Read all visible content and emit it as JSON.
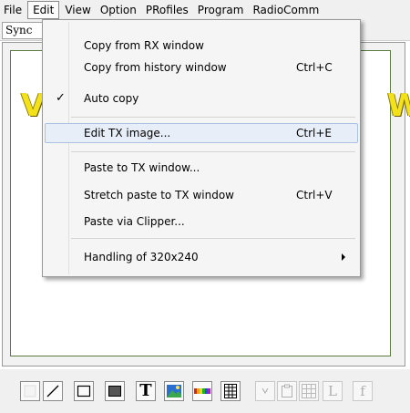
{
  "menubar": {
    "items": [
      "File",
      "Edit",
      "View",
      "Option",
      "PRofiles",
      "Program",
      "RadioComm"
    ],
    "active": "Edit"
  },
  "toolbar_row": {
    "sync_label": "Sync"
  },
  "canvas": {
    "left_text": "V",
    "right_text": "W",
    "text_color": "#f3e21a",
    "border_color": "#5a7a40"
  },
  "edit_menu": {
    "items": [
      {
        "label": "Copy from RX window",
        "shortcut": "",
        "checked": false
      },
      {
        "label": "Copy from history window",
        "shortcut": "Ctrl+C",
        "checked": false
      },
      {
        "label": "Auto copy",
        "shortcut": "",
        "checked": true,
        "check_glyph": "✓"
      },
      {
        "label": "Edit TX image...",
        "shortcut": "Ctrl+E",
        "highlighted": true
      },
      {
        "label": "Paste to TX window...",
        "shortcut": ""
      },
      {
        "label": "Stretch paste to TX window",
        "shortcut": "Ctrl+V"
      },
      {
        "label": "Paste via Clipper...",
        "shortcut": ""
      },
      {
        "label": "Handling of 320x240",
        "shortcut": "",
        "submenu": true
      }
    ]
  },
  "draw_tools": [
    {
      "name": "eraser-tool",
      "icon": "eraser-icon",
      "enabled": true
    },
    {
      "name": "line-tool",
      "icon": "line-icon",
      "enabled": true
    },
    {
      "name": "rectangle-tool",
      "icon": "rectangle-outline-icon",
      "enabled": true
    },
    {
      "name": "filled-rectangle-tool",
      "icon": "filled-rectangle-icon",
      "enabled": true
    },
    {
      "name": "text-tool",
      "icon": "text-T-icon",
      "glyph": "T",
      "enabled": true
    },
    {
      "name": "image-tool",
      "icon": "picture-icon",
      "enabled": true
    },
    {
      "name": "color-bar-tool",
      "icon": "color-bar-icon",
      "enabled": true
    },
    {
      "name": "grid-tool",
      "icon": "grid-icon",
      "enabled": true
    },
    {
      "name": "callsign-tool",
      "icon": "callsign-icon",
      "enabled": false
    },
    {
      "name": "clipboard-tool",
      "icon": "clipboard-icon",
      "enabled": false
    },
    {
      "name": "table-tool",
      "icon": "table-icon",
      "enabled": false
    },
    {
      "name": "label-tool",
      "icon": "label-L-icon",
      "glyph": "L",
      "enabled": false
    },
    {
      "name": "function-tool",
      "icon": "function-f-icon",
      "glyph": "f",
      "enabled": false
    }
  ]
}
